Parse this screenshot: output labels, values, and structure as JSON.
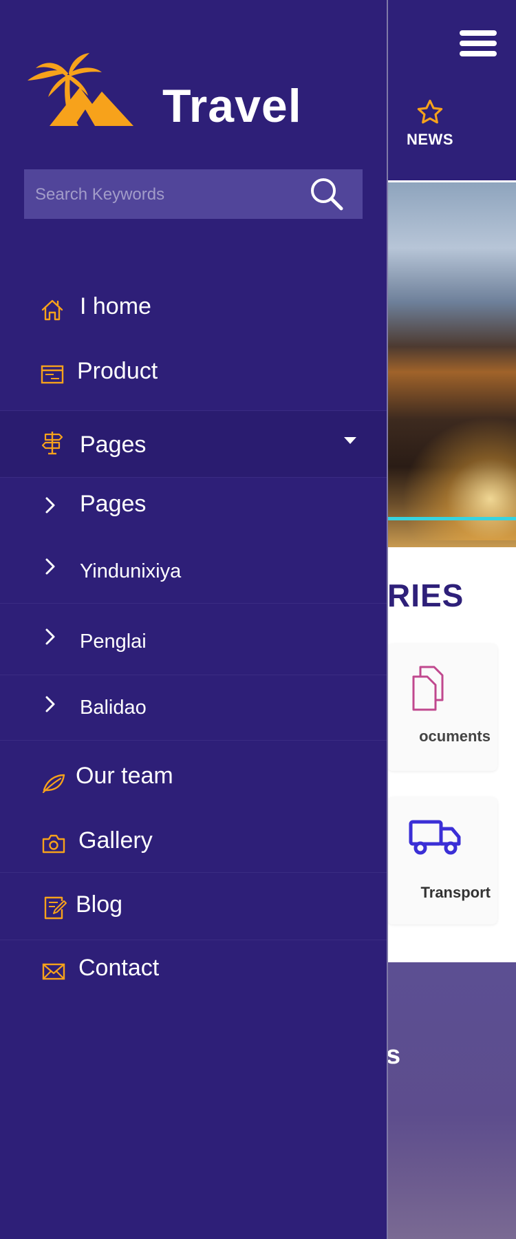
{
  "background": {
    "news_label": "NEWS",
    "section_title_fragment": "RIES",
    "categories": [
      {
        "label": "ocuments",
        "icon": "documents-icon"
      },
      {
        "label": "Transport",
        "icon": "truck-icon"
      }
    ],
    "band_text_fragment": "s"
  },
  "drawer": {
    "brand": "Travel",
    "search": {
      "placeholder": "Search Keywords"
    },
    "nav": {
      "home": "I home",
      "product": "Product",
      "pages": "Pages",
      "our_team": "Our team",
      "gallery": "Gallery",
      "blog": "Blog",
      "contact": "Contact"
    },
    "submenu": [
      "Pages",
      "Yindunixiya",
      "Penglai",
      "Balidao"
    ]
  },
  "colors": {
    "drawer_bg": "#2e1f78",
    "accent_orange": "#f7a21b",
    "search_bg": "#51459a"
  }
}
